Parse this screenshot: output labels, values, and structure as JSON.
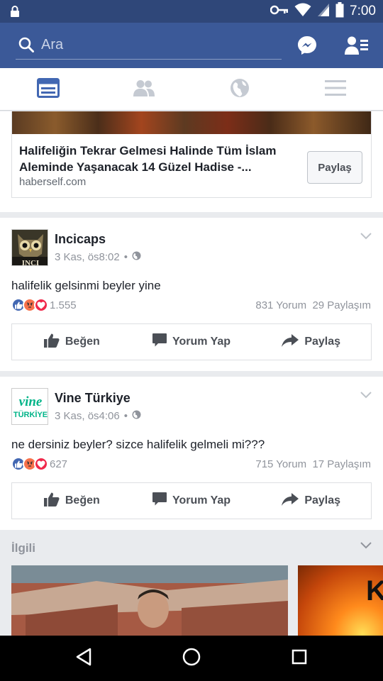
{
  "status_bar": {
    "time": "7:00"
  },
  "header": {
    "search_placeholder": "Ara"
  },
  "colors": {
    "brand": "#3b5998",
    "status_bar": "#2f4779",
    "like_blue": "#4267b2",
    "angry": "#f7714b",
    "love_red": "#f0284a",
    "vine_green": "#00b488"
  },
  "tabs": [
    {
      "icon": "news-feed-icon",
      "active": true
    },
    {
      "icon": "friends-icon",
      "active": false
    },
    {
      "icon": "globe-icon",
      "active": false
    },
    {
      "icon": "menu-icon",
      "active": false
    }
  ],
  "link_card": {
    "title": "Halifeliğin Tekrar Gelmesi Halinde Tüm İslam Aleminde Yaşanacak 14 Güzel Hadise -...",
    "domain": "haberself.com",
    "share_label": "Paylaş"
  },
  "posts": [
    {
      "author": "Incicaps",
      "time": "3 Kas, ös8:02",
      "text": "halifelik gelsinmi beyler yine",
      "reaction_count": "1.555",
      "comments": "831 Yorum",
      "shares": "29 Paylaşım",
      "actions": {
        "like": "Beğen",
        "comment": "Yorum Yap",
        "share": "Paylaş"
      }
    },
    {
      "author": "Vine Türkiye",
      "avatar_text_top": "vine",
      "avatar_text_bottom": "TÜRKİYE",
      "time": "3 Kas, ös4:06",
      "text": "ne dersiniz beyler? sizce halifelik gelmeli mi???",
      "reaction_count": "627",
      "comments": "715 Yorum",
      "shares": "17 Paylaşım",
      "actions": {
        "like": "Beğen",
        "comment": "Yorum Yap",
        "share": "Paylaş"
      }
    }
  ],
  "related": {
    "title": "İlgili",
    "thumb2_letter": "K"
  }
}
